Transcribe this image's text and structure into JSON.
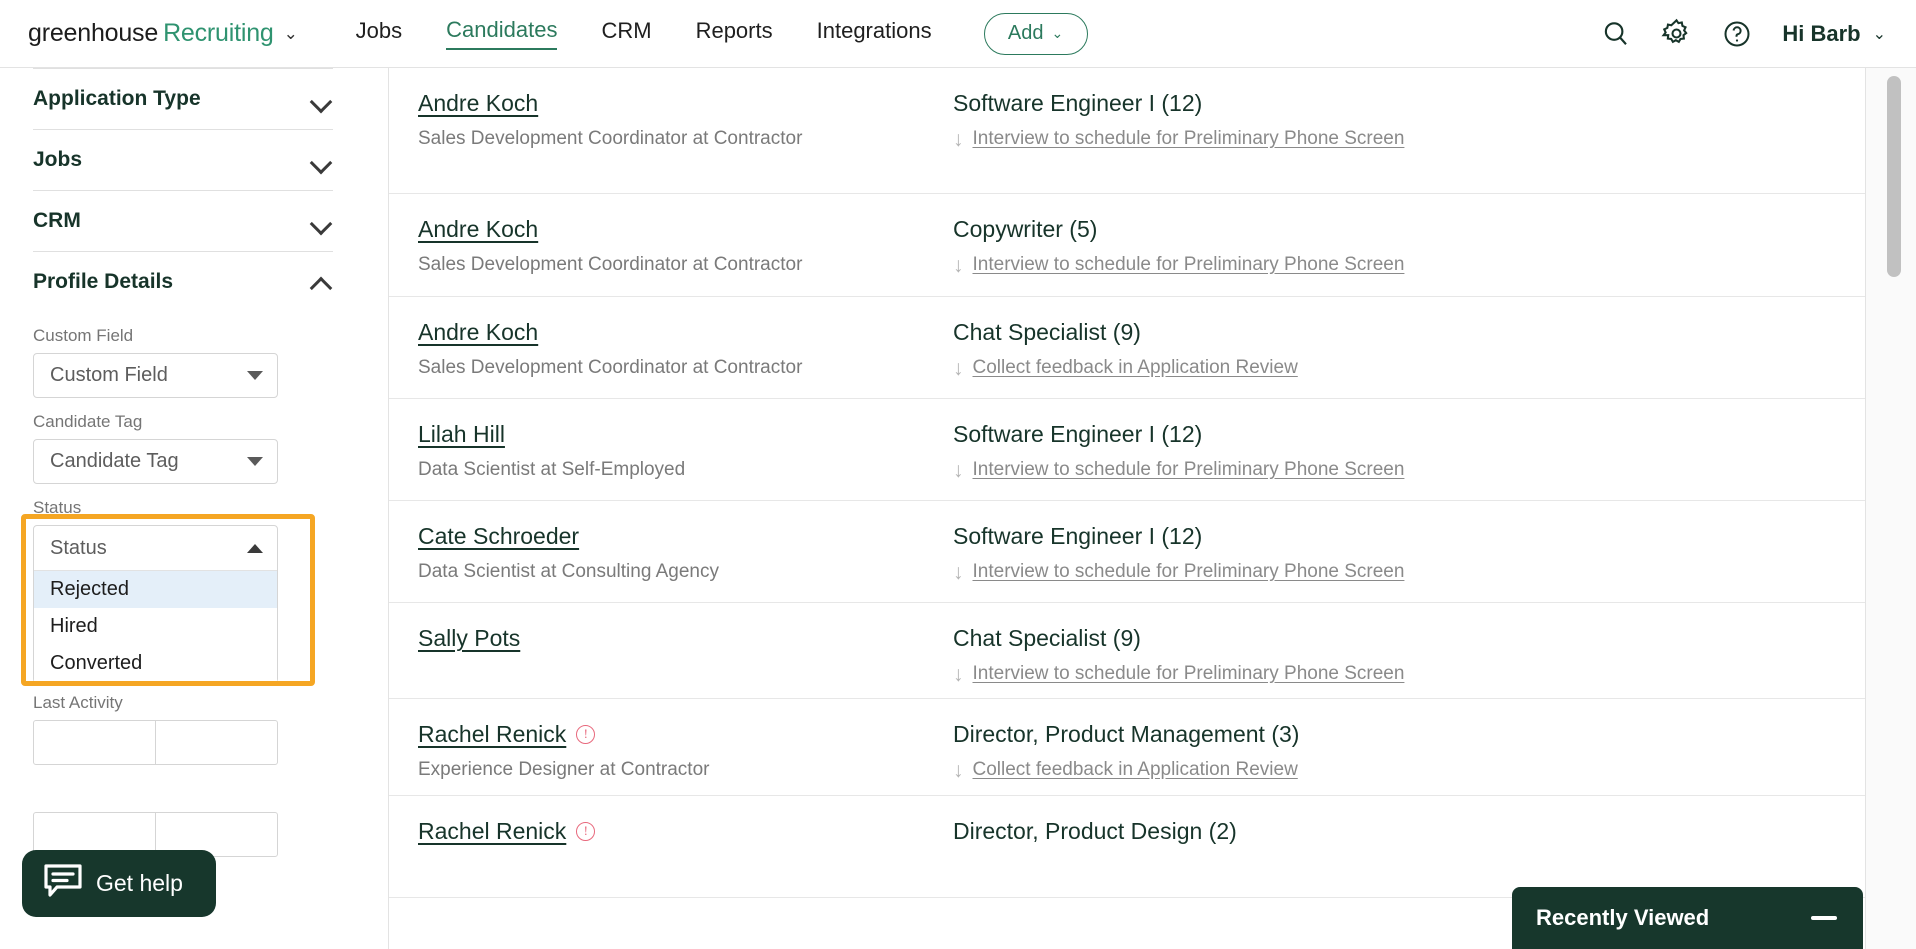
{
  "header": {
    "brand_word1": "greenhouse",
    "brand_word2": "Recruiting",
    "brand_caret": "⌄",
    "nav": [
      {
        "label": "Jobs",
        "active": false
      },
      {
        "label": "Candidates",
        "active": true
      },
      {
        "label": "CRM",
        "active": false
      },
      {
        "label": "Reports",
        "active": false
      },
      {
        "label": "Integrations",
        "active": false
      }
    ],
    "add_label": "Add",
    "add_caret": "⌄",
    "icons": [
      "search-icon",
      "gear-icon",
      "help-icon"
    ],
    "user_greeting": "Hi Barb",
    "user_caret": "⌄"
  },
  "sidebar": {
    "sections": [
      {
        "title": "Application Type",
        "expanded": false
      },
      {
        "title": "Jobs",
        "expanded": false
      },
      {
        "title": "CRM",
        "expanded": false
      },
      {
        "title": "Profile Details",
        "expanded": true
      }
    ],
    "custom_field": {
      "label": "Custom Field",
      "value": "Custom Field"
    },
    "candidate_tag": {
      "label": "Candidate Tag",
      "value": "Candidate Tag"
    },
    "status": {
      "label": "Status",
      "value": "Status",
      "options": [
        {
          "label": "Rejected",
          "highlighted": true
        },
        {
          "label": "Hired",
          "highlighted": false
        },
        {
          "label": "Converted",
          "highlighted": false
        }
      ],
      "highlight_color": "#f5a623",
      "option_hover_color": "#e4eff9"
    },
    "last_activity": {
      "label": "Last Activity",
      "from": "",
      "to": ""
    },
    "get_help": {
      "label": "Get help",
      "color": "#17372c"
    }
  },
  "candidates": [
    {
      "name": "Andre Koch",
      "subtitle": "Sales Development Coordinator at Contractor",
      "alert": false,
      "job": "Software Engineer I (12)",
      "status": "Interview to schedule for Preliminary Phone Screen"
    },
    {
      "name": "Andre Koch",
      "subtitle": "Sales Development Coordinator at Contractor",
      "alert": false,
      "job": "Copywriter (5)",
      "status": "Interview to schedule for Preliminary Phone Screen"
    },
    {
      "name": "Andre Koch",
      "subtitle": "Sales Development Coordinator at Contractor",
      "alert": false,
      "job": "Chat Specialist (9)",
      "status": "Collect feedback in Application Review"
    },
    {
      "name": "Lilah Hill",
      "subtitle": "Data Scientist at Self-Employed",
      "alert": false,
      "job": "Software Engineer I (12)",
      "status": "Interview to schedule for Preliminary Phone Screen"
    },
    {
      "name": "Cate Schroeder",
      "subtitle": "Data Scientist at Consulting Agency",
      "alert": false,
      "job": "Software Engineer I (12)",
      "status": "Interview to schedule for Preliminary Phone Screen"
    },
    {
      "name": "Sally Pots",
      "subtitle": "",
      "alert": false,
      "job": "Chat Specialist (9)",
      "status": "Interview to schedule for Preliminary Phone Screen"
    },
    {
      "name": "Rachel Renick",
      "subtitle": "Experience Designer at Contractor",
      "alert": true,
      "job": "Director, Product Management (3)",
      "status": "Collect feedback in Application Review"
    },
    {
      "name": "Rachel Renick",
      "subtitle": "",
      "alert": true,
      "job": "Director, Product Design (2)",
      "status": ""
    }
  ],
  "recently_viewed": {
    "title": "Recently Viewed",
    "collapse_icon": "minus-icon"
  }
}
